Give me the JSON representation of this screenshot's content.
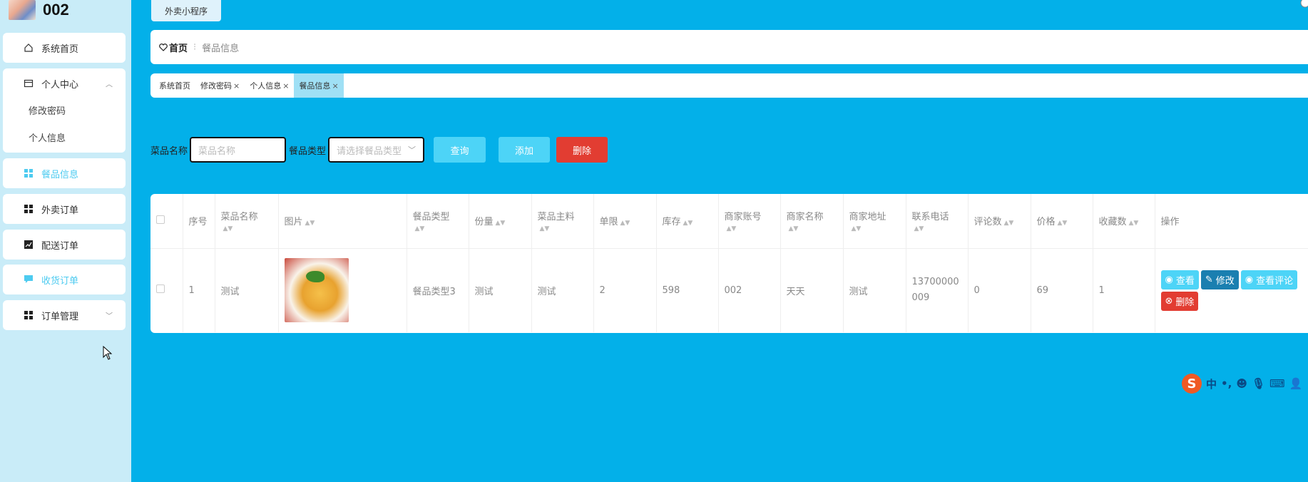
{
  "app": {
    "title": "002",
    "top_tab": "外卖小程序"
  },
  "sidebar": {
    "home": "系统首页",
    "personal": {
      "label": "个人中心",
      "children": [
        "修改密码",
        "个人信息"
      ]
    },
    "items": [
      "餐品信息",
      "外卖订单",
      "配送订单",
      "收货订单",
      "订单管理"
    ]
  },
  "breadcrumb": {
    "home": "首页",
    "current": "餐品信息"
  },
  "tabs": [
    {
      "label": "系统首页",
      "closable": false
    },
    {
      "label": "修改密码",
      "closable": true
    },
    {
      "label": "个人信息",
      "closable": true
    },
    {
      "label": "餐品信息",
      "closable": true,
      "active": true
    }
  ],
  "search": {
    "name_label": "菜品名称",
    "name_placeholder": "菜品名称",
    "type_label": "餐品类型",
    "type_placeholder": "请选择餐品类型",
    "query": "查询",
    "add": "添加",
    "delete": "删除"
  },
  "table": {
    "headers": [
      "序号",
      "菜品名称",
      "图片",
      "餐品类型",
      "份量",
      "菜品主料",
      "单限",
      "库存",
      "商家账号",
      "商家名称",
      "商家地址",
      "联系电话",
      "评论数",
      "价格",
      "收藏数",
      "操作"
    ],
    "rows": [
      {
        "no": "1",
        "name": "测试",
        "type": "餐品类型3",
        "portion": "测试",
        "main": "测试",
        "limit": "2",
        "stock": "598",
        "account": "002",
        "merchant": "天天",
        "address": "测试",
        "phone": "13700000009",
        "comments": "0",
        "price": "69",
        "favorites": "1"
      }
    ],
    "actions": {
      "view": "查看",
      "edit": "修改",
      "comments": "查看评论",
      "delete": "删除"
    }
  },
  "ime": {
    "label1": "中"
  }
}
